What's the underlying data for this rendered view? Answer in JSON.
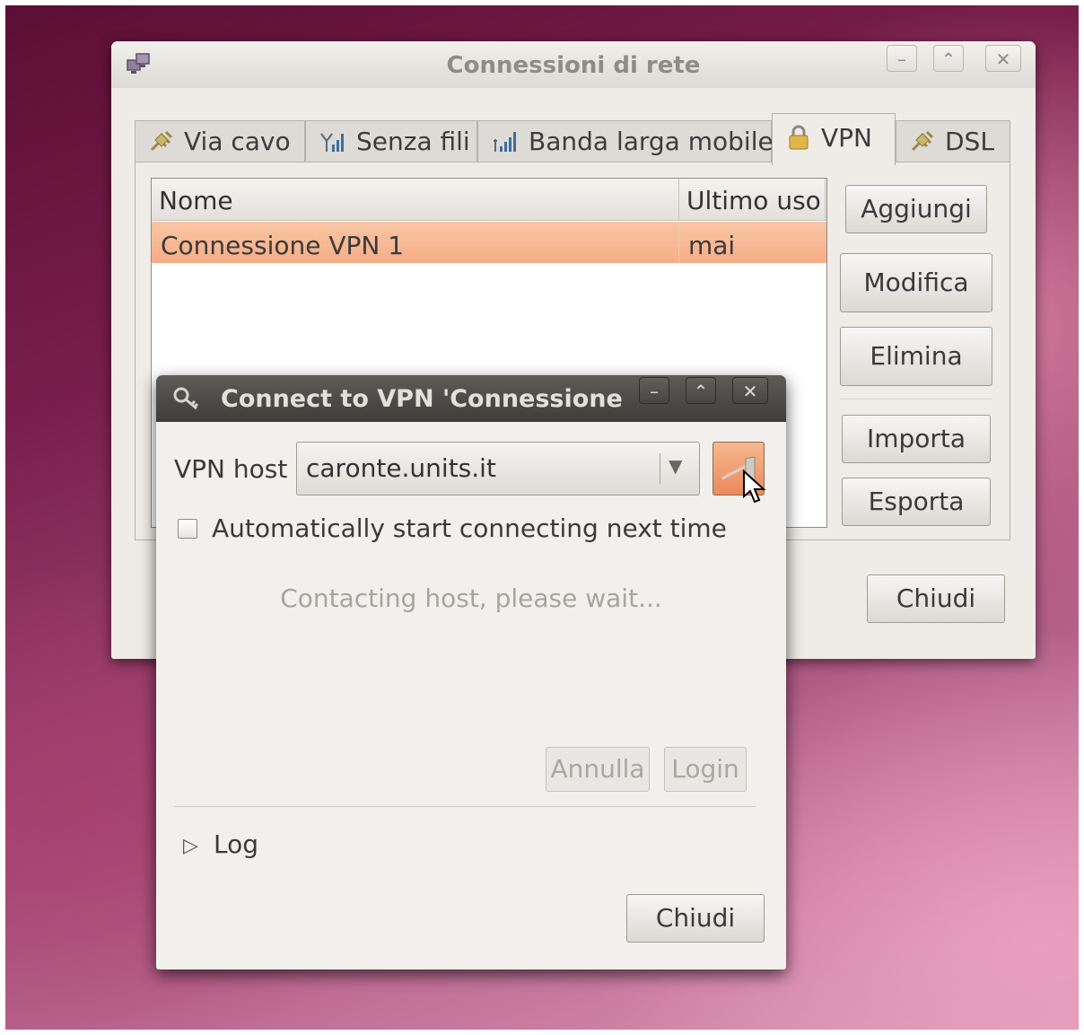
{
  "main_window": {
    "title": "Connessioni di rete",
    "tabs": [
      {
        "label": "Via cavo",
        "icon": "wired-icon"
      },
      {
        "label": "Senza fili",
        "icon": "wireless-signal-icon"
      },
      {
        "label": "Banda larga mobile",
        "icon": "mobile-signal-icon"
      },
      {
        "label": "VPN",
        "icon": "lock-icon",
        "active": true
      },
      {
        "label": "DSL",
        "icon": "dsl-icon"
      }
    ],
    "table": {
      "columns": [
        "Nome",
        "Ultimo uso"
      ],
      "rows": [
        {
          "name": "Connessione VPN 1",
          "last_used": "mai",
          "selected": true
        }
      ]
    },
    "buttons": {
      "add": "Aggiungi",
      "edit": "Modifica",
      "delete": "Elimina",
      "import": "Importa",
      "export": "Esporta",
      "close": "Chiudi"
    }
  },
  "dialog": {
    "title": "Connect to VPN 'Connessione V",
    "vpn_host_label": "VPN host",
    "vpn_host_value": "caronte.units.it",
    "auto_connect_label": "Automatically start connecting next time",
    "auto_connect_checked": false,
    "status": "Contacting host, please wait...",
    "buttons": {
      "cancel": "Annulla",
      "login": "Login",
      "close": "Chiudi"
    },
    "log_label": "Log"
  },
  "colors": {
    "selection": "#f6ad85",
    "connect_button": "#ea8a5c",
    "dialog_titlebar": "#3e3d3a"
  }
}
